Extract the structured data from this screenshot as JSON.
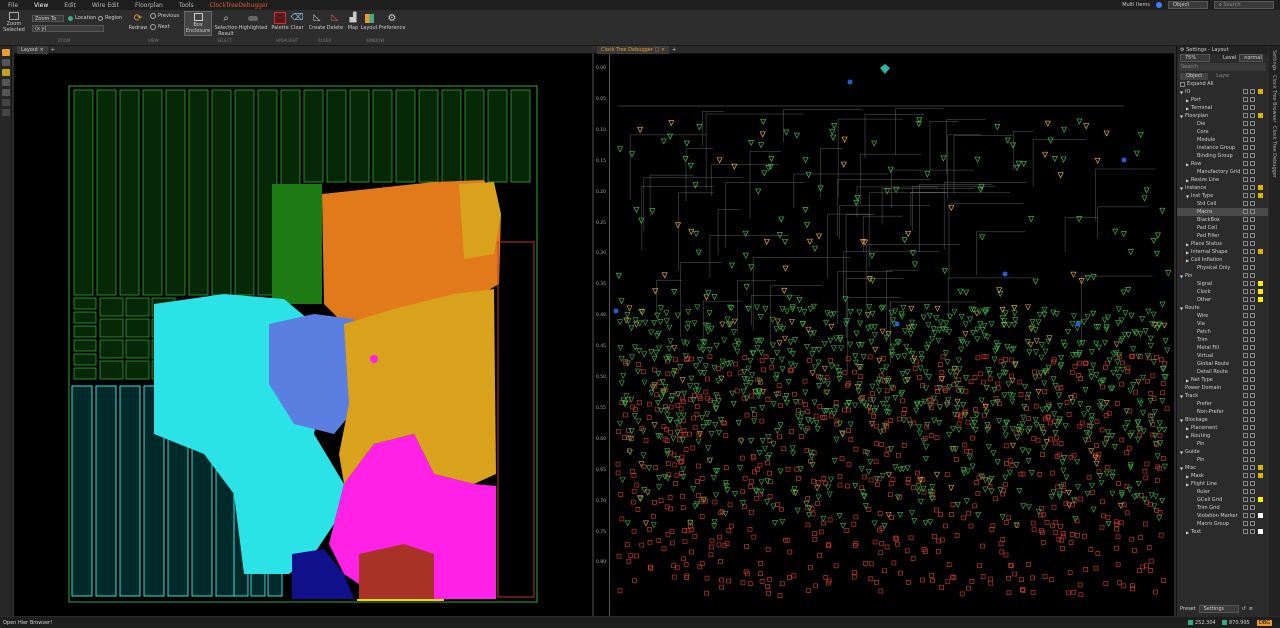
{
  "menubar": {
    "items": [
      "File",
      "View",
      "Edit",
      "Wire Edit",
      "Floorplan",
      "Tools"
    ],
    "context_tab": "ClockTreeDebugger",
    "multi_items": "Multi Items",
    "object_select": "Object",
    "search_placeholder": "Search"
  },
  "ribbon": {
    "zoom_selected": "Zoom\nSelected",
    "zoom_to": "Zoom To",
    "location": "Location",
    "region": "Region",
    "coord_value": "(x y)",
    "redraw": "Redraw",
    "previous": "Previous",
    "next": "Next",
    "box_enclosure": "Box\nEnclosure",
    "selection_result": "Selection\nResult",
    "highlighted": "Highlighted",
    "palette": "Palette",
    "clear": "Clear",
    "create": "Create",
    "delete": "Delete",
    "map": "Map",
    "layout": "Layout",
    "preference": "Preference",
    "groups": [
      "ZOOM",
      "VIEW",
      "SELECT",
      "HIGHLIGHT",
      "RULER",
      "WINDOW"
    ]
  },
  "layout_panel": {
    "tab": "Layout"
  },
  "clock_panel": {
    "tab": "Clock Tree Debugger",
    "yticks": [
      "0.00",
      "0.05",
      "0.10",
      "0.15",
      "0.20",
      "0.25",
      "0.30",
      "0.35",
      "0.40",
      "0.45",
      "0.50",
      "0.55",
      "0.60",
      "0.65",
      "0.70",
      "0.75",
      "0.80"
    ]
  },
  "settings": {
    "title": "Settings - Layout",
    "zoom": "75%",
    "level_label": "Level",
    "level_value": "normal",
    "search_placeholder": "Search",
    "tab_object": "Object",
    "tab_layer": "Layer",
    "expand_all": "Expand All",
    "preset_label": "Preset",
    "preset_value": "Settings",
    "tree": [
      {
        "label": "IO",
        "level": 0,
        "arrow": "▼",
        "sw": "#d9b400"
      },
      {
        "label": "Port",
        "level": 1,
        "arrow": "▶",
        "sw": ""
      },
      {
        "label": "Terminal",
        "level": 1,
        "arrow": "▶",
        "sw": ""
      },
      {
        "label": "Floorplan",
        "level": 0,
        "arrow": "▼",
        "sw": "#d9b400"
      },
      {
        "label": "Die",
        "level": 2,
        "arrow": "",
        "sw": ""
      },
      {
        "label": "Core",
        "level": 2,
        "arrow": "",
        "sw": ""
      },
      {
        "label": "Module",
        "level": 2,
        "arrow": "",
        "sw": ""
      },
      {
        "label": "Instance Group",
        "level": 2,
        "arrow": "",
        "sw": ""
      },
      {
        "label": "Binding Group",
        "level": 2,
        "arrow": "",
        "sw": ""
      },
      {
        "label": "Row",
        "level": 1,
        "arrow": "▶",
        "sw": ""
      },
      {
        "label": "Manufactory Grid",
        "level": 2,
        "arrow": "",
        "sw": ""
      },
      {
        "label": "Resize Line",
        "level": 1,
        "arrow": "▶",
        "sw": ""
      },
      {
        "label": "Instance",
        "level": 0,
        "arrow": "▼",
        "sw": "#d9b400"
      },
      {
        "label": "Inst Type",
        "level": 1,
        "arrow": "▼",
        "sw": "#d9b400"
      },
      {
        "label": "Std Cell",
        "level": 2,
        "arrow": "",
        "sw": ""
      },
      {
        "label": "Macro",
        "level": 2,
        "arrow": "",
        "sw": "",
        "sel": true
      },
      {
        "label": "BlackBox",
        "level": 2,
        "arrow": "",
        "sw": ""
      },
      {
        "label": "Pad Cell",
        "level": 2,
        "arrow": "",
        "sw": ""
      },
      {
        "label": "Pad Filler",
        "level": 2,
        "arrow": "",
        "sw": ""
      },
      {
        "label": "Place Status",
        "level": 1,
        "arrow": "▶",
        "sw": ""
      },
      {
        "label": "Internal Shape",
        "level": 1,
        "arrow": "▶",
        "sw": "#d9b400"
      },
      {
        "label": "Cell Inflation",
        "level": 1,
        "arrow": "▶",
        "sw": ""
      },
      {
        "label": "Physical Only",
        "level": 2,
        "arrow": "",
        "sw": ""
      },
      {
        "label": "Pin",
        "level": 0,
        "arrow": "▼",
        "sw": ""
      },
      {
        "label": "Signal",
        "level": 2,
        "arrow": "",
        "sw": "#ffee00"
      },
      {
        "label": "Clock",
        "level": 2,
        "arrow": "",
        "sw": "#ffee00"
      },
      {
        "label": "Other",
        "level": 2,
        "arrow": "",
        "sw": "#ffee00"
      },
      {
        "label": "Route",
        "level": 0,
        "arrow": "▼",
        "sw": ""
      },
      {
        "label": "Wire",
        "level": 2,
        "arrow": "",
        "sw": ""
      },
      {
        "label": "Via",
        "level": 2,
        "arrow": "",
        "sw": ""
      },
      {
        "label": "Patch",
        "level": 2,
        "arrow": "",
        "sw": ""
      },
      {
        "label": "Trim",
        "level": 2,
        "arrow": "",
        "sw": ""
      },
      {
        "label": "Metal Fill",
        "level": 2,
        "arrow": "",
        "sw": ""
      },
      {
        "label": "Virtual",
        "level": 2,
        "arrow": "",
        "sw": ""
      },
      {
        "label": "Global Route",
        "level": 2,
        "arrow": "",
        "sw": ""
      },
      {
        "label": "Detail Route",
        "level": 2,
        "arrow": "",
        "sw": ""
      },
      {
        "label": "Net Type",
        "level": 1,
        "arrow": "▶",
        "sw": ""
      },
      {
        "label": "Power Domain",
        "level": 0,
        "arrow": "",
        "sw": ""
      },
      {
        "label": "Track",
        "level": 0,
        "arrow": "▼",
        "sw": ""
      },
      {
        "label": "Prefer",
        "level": 2,
        "arrow": "",
        "sw": ""
      },
      {
        "label": "Non-Prefer",
        "level": 2,
        "arrow": "",
        "sw": ""
      },
      {
        "label": "Blockage",
        "level": 0,
        "arrow": "▼",
        "sw": ""
      },
      {
        "label": "Placement",
        "level": 1,
        "arrow": "▶",
        "sw": ""
      },
      {
        "label": "Routing",
        "level": 1,
        "arrow": "▶",
        "sw": ""
      },
      {
        "label": "Pin",
        "level": 2,
        "arrow": "",
        "sw": ""
      },
      {
        "label": "Guide",
        "level": 0,
        "arrow": "▼",
        "sw": ""
      },
      {
        "label": "Pin",
        "level": 2,
        "arrow": "",
        "sw": ""
      },
      {
        "label": "Misc",
        "level": 0,
        "arrow": "▼",
        "sw": "#d9b400"
      },
      {
        "label": "Mask",
        "level": 1,
        "arrow": "▶",
        "sw": "#d9b400"
      },
      {
        "label": "Flight Line",
        "level": 1,
        "arrow": "▶",
        "sw": ""
      },
      {
        "label": "Ruler",
        "level": 2,
        "arrow": "",
        "sw": ""
      },
      {
        "label": "GCell Grid",
        "level": 2,
        "arrow": "",
        "sw": "#ffee00"
      },
      {
        "label": "Trim Grid",
        "level": 2,
        "arrow": "",
        "sw": ""
      },
      {
        "label": "Violation Marker",
        "level": 2,
        "arrow": "",
        "sw": "#ffffff"
      },
      {
        "label": "Macro Group",
        "level": 2,
        "arrow": "",
        "sw": ""
      },
      {
        "label": "Text",
        "level": 1,
        "arrow": "▶",
        "sw": "#ffffff"
      }
    ]
  },
  "right_rail": [
    "Settings",
    "Clock Tree Browser",
    "Clock Tree Debugger"
  ],
  "statusbar": {
    "message": "Open Hier Browser!",
    "coord_x": "252.304",
    "coord_y": "870.995",
    "badge": "DBG"
  }
}
